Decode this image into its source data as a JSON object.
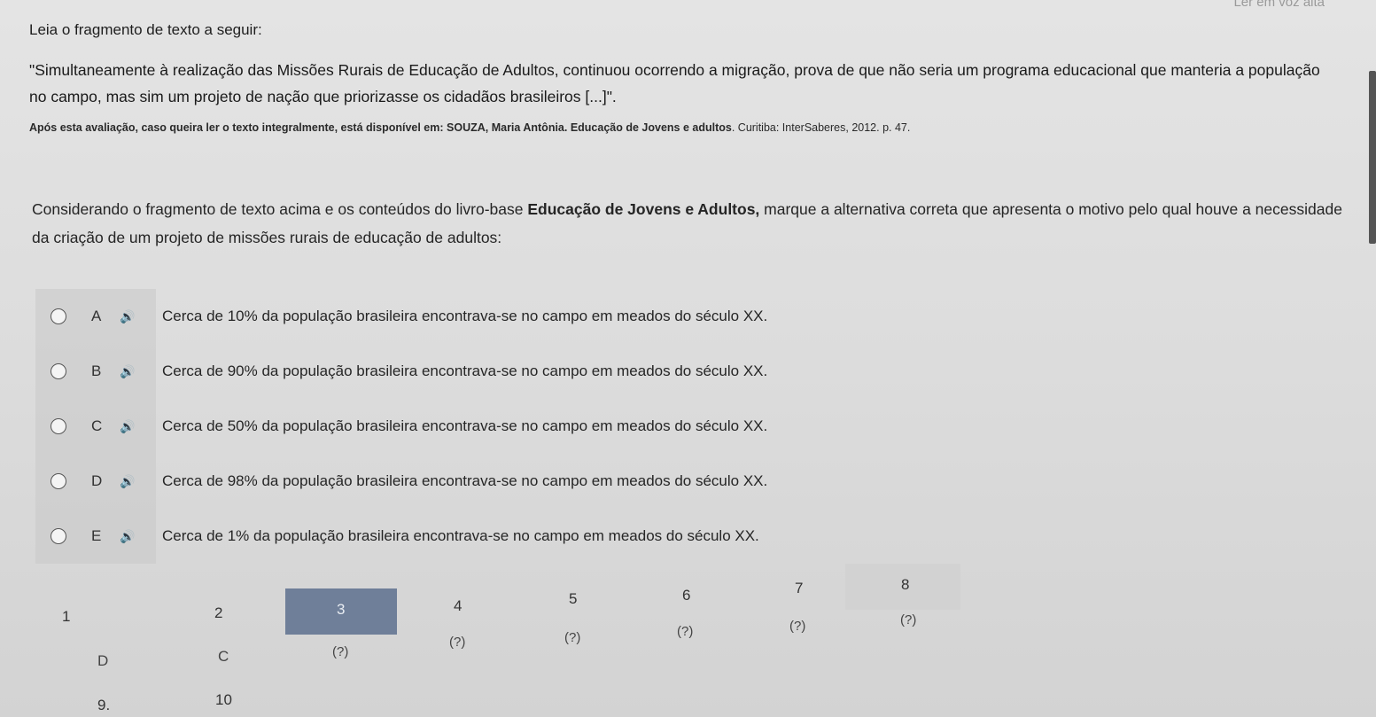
{
  "header": {
    "top_right": "Ler em voz alta"
  },
  "intro": "Leia o fragmento de texto a seguir:",
  "quote": "\"Simultaneamente à realização das Missões Rurais de Educação de Adultos, continuou ocorrendo a migração, prova de que não seria um programa educacional que manteria a população no campo, mas sim um projeto de nação que priorizasse os cidadãos brasileiros [...]\".",
  "citation": {
    "prefix": "Após esta avaliação, caso queira ler o texto integralmente, está disponível em: SOUZA, Maria Antônia. ",
    "book": "Educação de Jovens e adultos",
    "suffix": ". Curitiba: InterSaberes, 2012. p. 47."
  },
  "question": {
    "before": "Considerando o fragmento de texto acima e os conteúdos do livro-base ",
    "book": "Educação de Jovens e Adultos,",
    "after": " marque a alternativa correta que apresenta o motivo pelo qual houve a necessidade da criação de um projeto de missões rurais de educação de adultos:"
  },
  "options": [
    {
      "letter": "A",
      "text": "Cerca de 10% da população brasileira encontrava-se no campo em meados do século XX."
    },
    {
      "letter": "B",
      "text": "Cerca de 90% da população brasileira encontrava-se no campo em meados do século XX."
    },
    {
      "letter": "C",
      "text": "Cerca de 50% da população brasileira encontrava-se no campo em meados do século XX."
    },
    {
      "letter": "D",
      "text": "Cerca de 98% da população brasileira encontrava-se no campo em meados do século XX."
    },
    {
      "letter": "E",
      "text": "Cerca de 1% da população brasileira encontrava-se no campo em meados do século XX."
    }
  ],
  "speaker_icon": "speaker-icon",
  "navigation": {
    "cells": [
      {
        "num": "1",
        "answer": "D"
      },
      {
        "num": "2",
        "answer": "C"
      },
      {
        "num": "3",
        "answer": "(?)"
      },
      {
        "num": "4",
        "answer": "(?)"
      },
      {
        "num": "5",
        "answer": "(?)"
      },
      {
        "num": "6",
        "answer": "(?)"
      },
      {
        "num": "7",
        "answer": "(?)"
      },
      {
        "num": "8",
        "answer": "(?)"
      }
    ],
    "row2": [
      "9.",
      "10"
    ],
    "active_color": "#6f7f99"
  }
}
